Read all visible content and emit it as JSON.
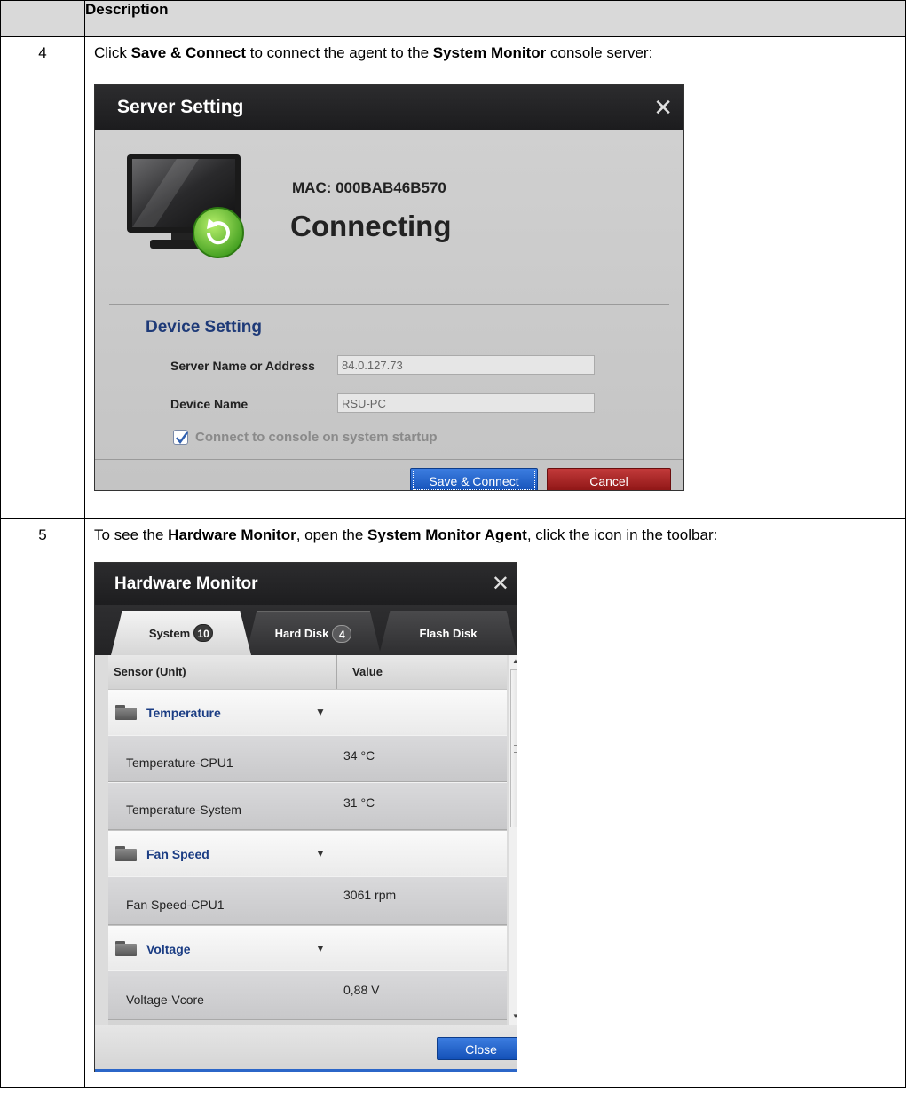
{
  "table": {
    "header_col1": "",
    "header_col2": "Description"
  },
  "step4": {
    "number": "4",
    "text_1": "Click ",
    "bold_1": "Save & Connect",
    "text_2": " to connect the agent to the ",
    "bold_2": "System Monitor",
    "text_3": " console server:"
  },
  "server_setting": {
    "title": "Server Setting",
    "close_glyph": "✕",
    "mac": "MAC: 000BAB46B570",
    "status": "Connecting",
    "device_setting_title": "Device Setting",
    "server_label": "Server Name or Address",
    "server_value": "84.0.127.73",
    "device_label": "Device Name",
    "device_value": "RSU-PC",
    "checkbox_label": "Connect to console on system startup",
    "checkbox_checked": true,
    "save_button": "Save & Connect",
    "cancel_button": "Cancel"
  },
  "step5": {
    "number": "5",
    "text_1": "To see the ",
    "bold_1": "Hardware Monitor",
    "text_2": ", open the ",
    "bold_2": "System Monitor Agent",
    "text_3": ", click the icon in the toolbar:"
  },
  "hardware_monitor": {
    "title": "Hardware Monitor",
    "close_glyph": "✕",
    "tabs": [
      {
        "label": "System",
        "count": "10"
      },
      {
        "label": "Hard Disk",
        "count": "4"
      },
      {
        "label": "Flash Disk",
        "count": ""
      }
    ],
    "columns": {
      "sensor": "Sensor (Unit)",
      "value": "Value"
    },
    "groups": [
      {
        "name": "Temperature",
        "items": [
          {
            "name": "Temperature-CPU1",
            "value": "34 °C"
          },
          {
            "name": "Temperature-System",
            "value": "31 °C"
          }
        ]
      },
      {
        "name": "Fan Speed",
        "items": [
          {
            "name": "Fan Speed-CPU1",
            "value": "3061 rpm"
          }
        ]
      },
      {
        "name": "Voltage",
        "items": [
          {
            "name": "Voltage-Vcore",
            "value": "0,88 V"
          }
        ]
      }
    ],
    "caret_glyph": "▼",
    "close_button": "Close"
  },
  "colors": {
    "accent_blue": "#1451b8",
    "cancel_red": "#8c1414",
    "group_text": "#1b3d84"
  }
}
